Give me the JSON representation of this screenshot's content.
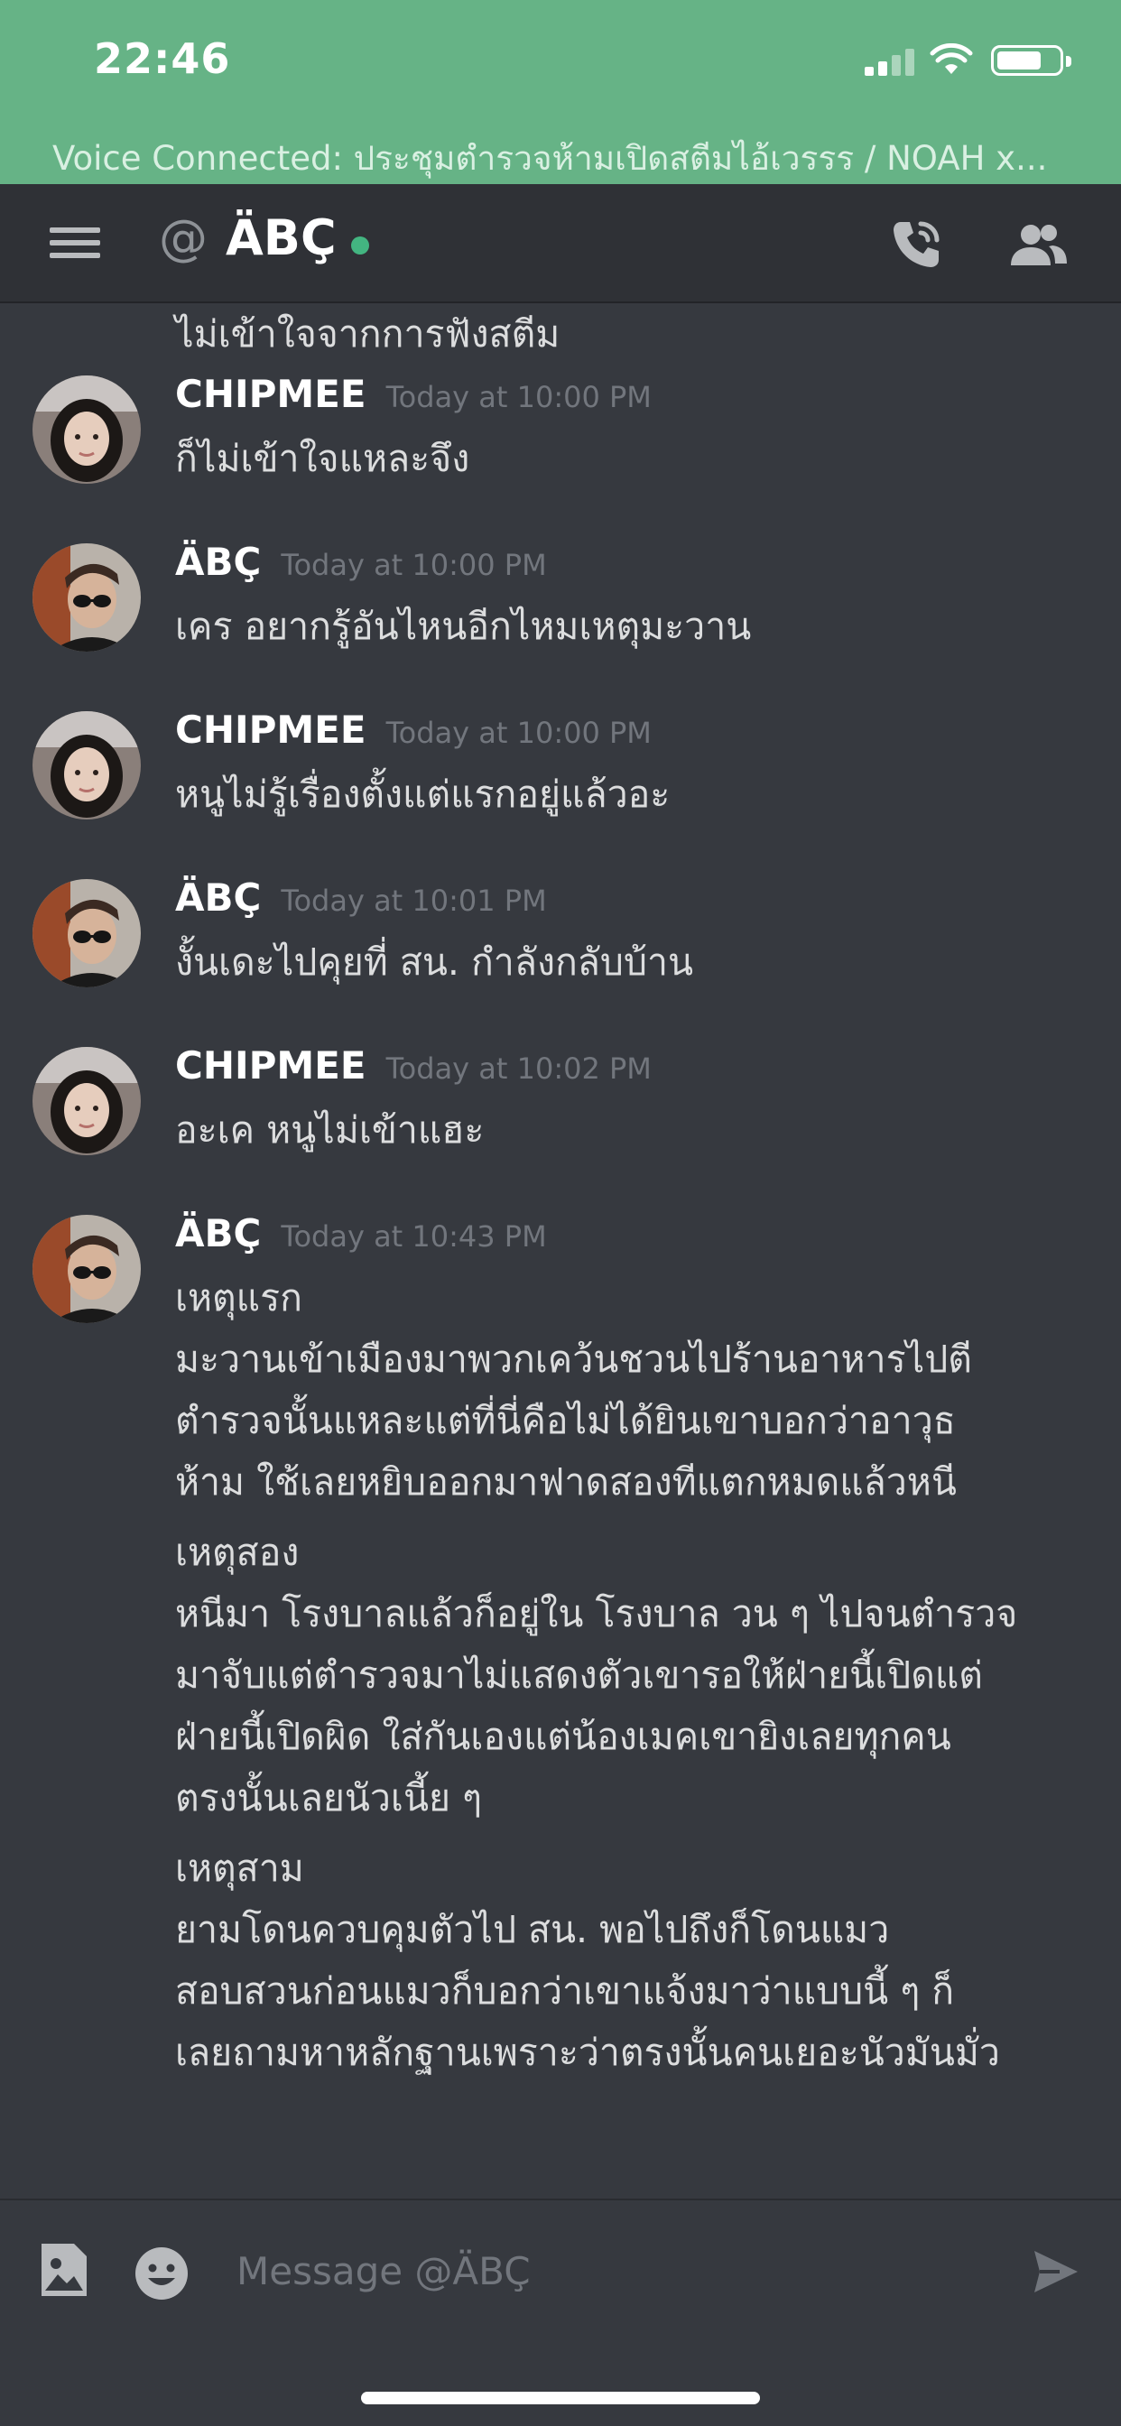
{
  "status_bar": {
    "time": "22:46",
    "icons": [
      "cellular-signal-icon",
      "wifi-icon",
      "battery-icon"
    ]
  },
  "voice_banner": {
    "text": "Voice Connected: ประชุมตำรวจห้ามเปิดสตีมไอ้เวรรร / NOAH x..."
  },
  "header": {
    "at_symbol": "@",
    "channel_name": "ÄBÇ",
    "icons": [
      "menu-icon",
      "call-icon",
      "members-icon"
    ]
  },
  "colors": {
    "banner": "#66b386",
    "background": "#36393f",
    "header": "#2f3136",
    "online": "#43b581",
    "timestamp": "#72767d"
  },
  "messages": {
    "continuation": "ไม่เข้าใจจากการฟังสตีม",
    "items": [
      {
        "author": "CHIPMEE",
        "time": "Today at 10:00 PM",
        "lines": [
          "ก็ไม่เข้าใจแหละจึง"
        ]
      },
      {
        "author": "ÄBÇ",
        "time": "Today at 10:00 PM",
        "lines": [
          "เคร อยากรู้อันไหนอีกไหมเหตุมะวาน"
        ]
      },
      {
        "author": "CHIPMEE",
        "time": "Today at 10:00 PM",
        "lines": [
          "หนูไม่รู้เรื่องตั้งแต่แรกอยู่แล้วอะ"
        ]
      },
      {
        "author": "ÄBÇ",
        "time": "Today at 10:01 PM",
        "lines": [
          "งั้นเดะไปคุยที่ สน. กำลังกลับบ้าน"
        ]
      },
      {
        "author": "CHIPMEE",
        "time": "Today at 10:02 PM",
        "lines": [
          "อะเค หนูไม่เข้าแฮะ"
        ]
      },
      {
        "author": "ÄBÇ",
        "time": "Today at 10:43 PM",
        "paragraphs": [
          [
            "เหตุแรก",
            "มะวานเข้าเมืองมาพวกเคว้นชวนไปร้านอาหารไปตี",
            "ตำรวจนั้นแหละแต่ที่นี่คือไม่ได้ยินเขาบอกว่าอาวุธ",
            "ห้าม ใช้เลยหยิบออกมาฟาดสองทีแตกหมดแล้วหนี"
          ],
          [
            "เหตุสอง",
            "หนีมา โรงบาลแล้วก็อยู่ใน โรงบาล วน ๆ ไปจนตำรวจ",
            "มาจับแต่ตำรวจมาไม่แสดงตัวเขารอให้ฝ่ายนี้เปิดแต่",
            "ฝ่ายนี้เปิดผิด ใส่กันเองแต่น้องเมคเขายิงเลยทุกคน",
            "ตรงนั้นเลยนัวเนี้ย ๆ"
          ],
          [
            "เหตุสาม",
            "ยามโดนควบคุมตัวไป สน. พอไปถึงก็โดนแมว",
            "สอบสวนก่อนแมวก็บอกว่าเขาแจ้งมาว่าแบบนี้ ๆ ก็",
            "เลยถามหาหลักฐานเพราะว่าตรงนั้นคนเยอะนัวมันมั่ว"
          ]
        ]
      }
    ]
  },
  "composer": {
    "placeholder": "Message @ÄBÇ",
    "icons": [
      "image-attach-icon",
      "emoji-icon",
      "send-icon"
    ]
  }
}
